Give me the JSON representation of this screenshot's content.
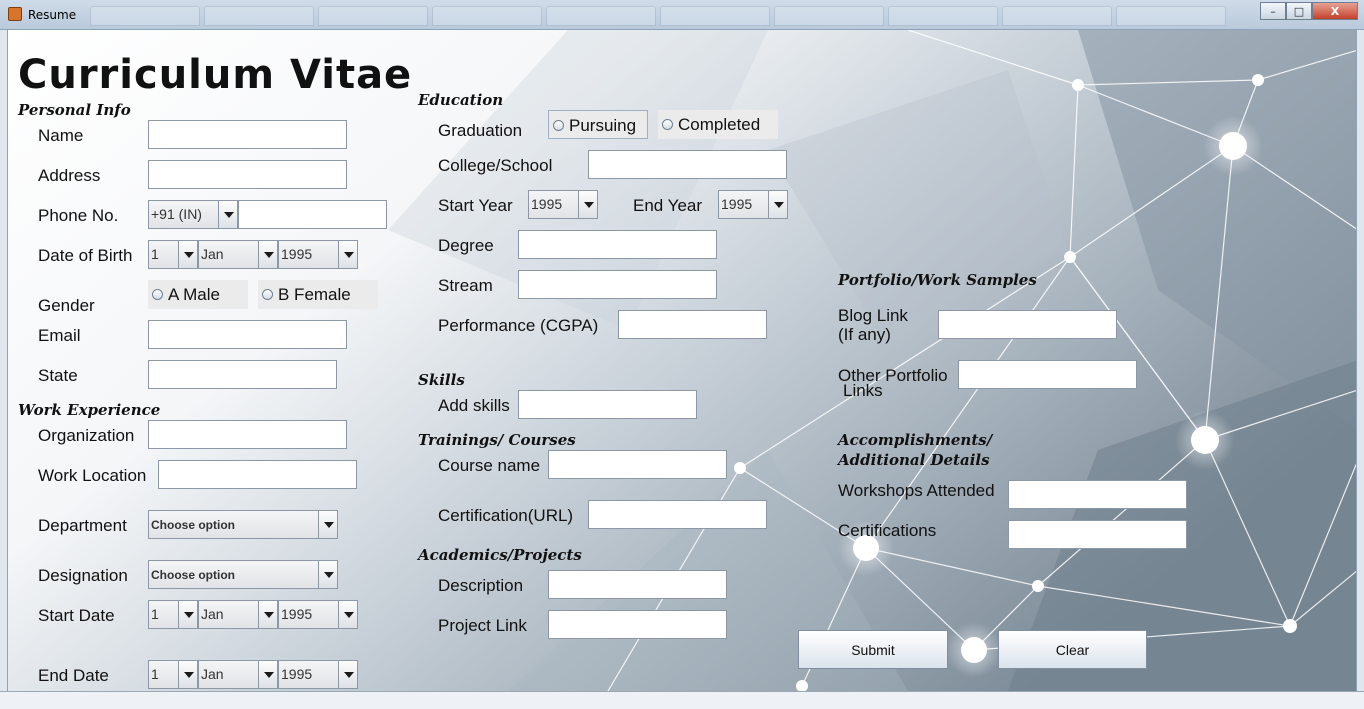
{
  "window": {
    "title": "Resume",
    "controls": [
      "–",
      "□",
      "X"
    ]
  },
  "heading": "Curriculum Vitae",
  "sections": {
    "personal": "Personal Info",
    "work": "Work Experience",
    "education": "Education",
    "skills": "Skills",
    "trainings": "Trainings/ Courses",
    "academics": "Academics/Projects",
    "portfolio": "Portfolio/Work Samples",
    "accomplishments_line1": "Accomplishments/",
    "accomplishments_line2": "Additional Details"
  },
  "personal": {
    "name_label": "Name",
    "address_label": "Address",
    "phone_label": "Phone No.",
    "phone_code": "+91 (IN)",
    "dob_label": "Date of Birth",
    "dob_day": "1",
    "dob_month": "Jan",
    "dob_year": "1995",
    "gender_label": "Gender",
    "gender_male": "A Male",
    "gender_female": "B Female",
    "email_label": "Email",
    "state_label": "State"
  },
  "work": {
    "org_label": "Organization",
    "location_label": "Work Location",
    "dept_label": "Department",
    "dept_value": "Choose option",
    "desig_label": "Designation",
    "desig_value": "Choose option",
    "start_label": "Start Date",
    "start_day": "1",
    "start_month": "Jan",
    "start_year": "1995",
    "end_label": "End Date",
    "end_day": "1",
    "end_month": "Jan",
    "end_year": "1995"
  },
  "education": {
    "graduation_label": "Graduation",
    "pursuing": "Pursuing",
    "completed": "Completed",
    "college_label": "College/School",
    "start_year_label": "Start Year",
    "start_year": "1995",
    "end_year_label": "End Year",
    "end_year": "1995",
    "degree_label": "Degree",
    "stream_label": "Stream",
    "performance_label": "Performance (CGPA)"
  },
  "skills": {
    "add_label": "Add skills"
  },
  "trainings": {
    "course_label": "Course name",
    "cert_label": "Certification(URL)"
  },
  "academics": {
    "desc_label": "Description",
    "link_label": "Project Link"
  },
  "portfolio": {
    "blog_line1": "Blog Link",
    "blog_line2": "(If any)",
    "other_line1": "Other Portfolio",
    "other_line2": "Links"
  },
  "accomplishments": {
    "workshops_label": "Workshops Attended",
    "certs_label": "Certifications"
  },
  "buttons": {
    "submit": "Submit",
    "clear": "Clear"
  }
}
